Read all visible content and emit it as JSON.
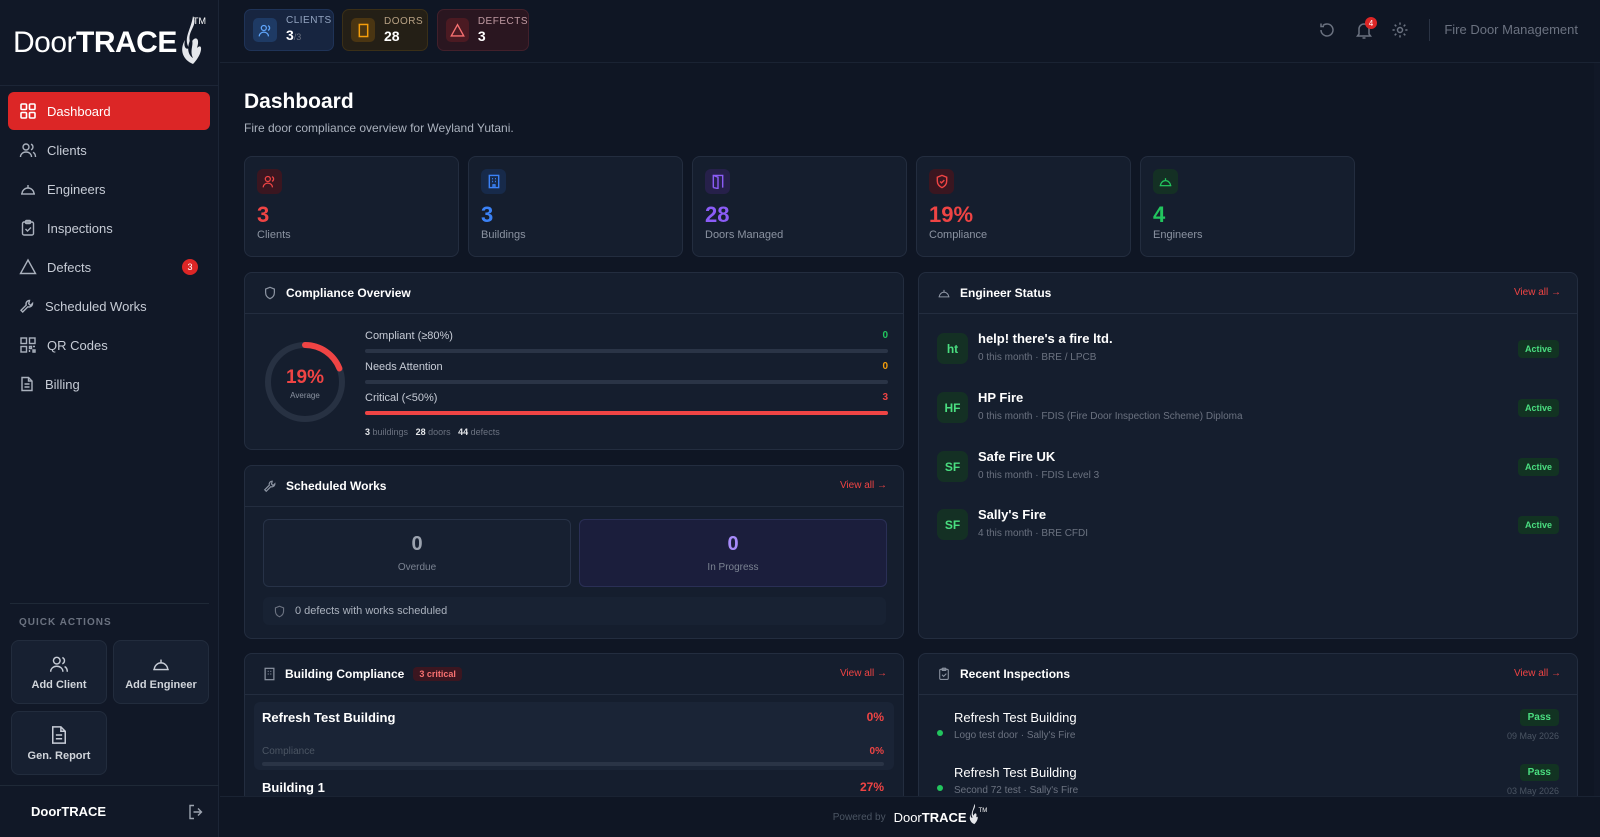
{
  "brand": {
    "prefix": "Door",
    "suffix": "TRACE",
    "tm": "TM"
  },
  "nav": {
    "dashboard": "Dashboard",
    "clients": "Clients",
    "engineers": "Engineers",
    "inspections": "Inspections",
    "defects": "Defects",
    "defects_badge": "3",
    "scheduled": "Scheduled Works",
    "qr": "QR Codes",
    "billing": "Billing"
  },
  "quick_actions": {
    "title": "QUICK ACTIONS",
    "add_client": "Add Client",
    "add_engineer": "Add Engineer",
    "gen_report": "Gen. Report"
  },
  "sidebar_footer": {
    "name": "DoorTRACE"
  },
  "topbar": {
    "clients_label": "CLIENTS",
    "clients_value": "3",
    "clients_total": "/3",
    "doors_label": "DOORS",
    "doors_value": "28",
    "defects_label": "DEFECTS",
    "defects_value": "3",
    "notif_count": "4",
    "title": "Fire Door Management"
  },
  "page": {
    "title": "Dashboard",
    "subtitle": "Fire door compliance overview for Weyland Yutani."
  },
  "stats": [
    {
      "value": "3",
      "caption": "Clients"
    },
    {
      "value": "3",
      "caption": "Buildings"
    },
    {
      "value": "28",
      "caption": "Doors Managed"
    },
    {
      "value": "19%",
      "caption": "Compliance"
    },
    {
      "value": "4",
      "caption": "Engineers"
    }
  ],
  "compliance": {
    "title": "Compliance Overview",
    "average_value": "19%",
    "average_pct": 19,
    "average_label": "Average",
    "rows": [
      {
        "label": "Compliant (≥80%)",
        "value": "0",
        "fraction": 0
      },
      {
        "label": "Needs Attention",
        "value": "0",
        "fraction": 0
      },
      {
        "label": "Critical (<50%)",
        "value": "3",
        "fraction": 1
      }
    ],
    "buildings": "3",
    "buildings_label": "buildings",
    "doors": "28",
    "doors_label": "doors",
    "defects": "44",
    "defects_label": "defects"
  },
  "scheduled": {
    "title": "Scheduled Works",
    "view_all": "View all →",
    "overdue_value": "0",
    "overdue_label": "Overdue",
    "progress_value": "0",
    "progress_label": "In Progress",
    "footer": "0 defects with works scheduled"
  },
  "engineers": {
    "title": "Engineer Status",
    "view_all": "View all →",
    "items": [
      {
        "initials": "ht",
        "name": "help! there's a fire ltd.",
        "meta": "0 this month · BRE / LPCB",
        "status": "Active"
      },
      {
        "initials": "HF",
        "name": "HP Fire",
        "meta": "0 this month · FDIS (Fire Door Inspection Scheme) Diploma",
        "status": "Active"
      },
      {
        "initials": "SF",
        "name": "Safe Fire UK",
        "meta": "0 this month · FDIS Level 3",
        "status": "Active"
      },
      {
        "initials": "SF",
        "name": "Sally's Fire",
        "meta": "4 this month · BRE CFDI",
        "status": "Active"
      }
    ]
  },
  "building_compliance": {
    "title": "Building Compliance",
    "badge": "3 critical",
    "view_all": "View all →",
    "items": [
      {
        "name": "Refresh Test Building",
        "pct": "0%",
        "sub_label": "Compliance",
        "sub_value": "0%",
        "fraction": 0
      },
      {
        "name": "Building 1",
        "pct": "27%"
      }
    ]
  },
  "recent": {
    "title": "Recent Inspections",
    "view_all": "View all →",
    "items": [
      {
        "name": "Refresh Test Building",
        "meta": "Logo test door · Sally's Fire",
        "status": "Pass",
        "date": "09 May 2026"
      },
      {
        "name": "Refresh Test Building",
        "meta": "Second 72 test · Sally's Fire",
        "status": "Pass",
        "date": "03 May 2026"
      }
    ]
  },
  "footer": {
    "powered": "Powered by",
    "prefix": "Door",
    "suffix": "TRACE",
    "tm": "TM"
  },
  "colors": {
    "accent": "#dc2626",
    "blue": "#3b82f6",
    "purple": "#8b5cf6",
    "green": "#22c55e",
    "orange": "#f59e0b"
  }
}
